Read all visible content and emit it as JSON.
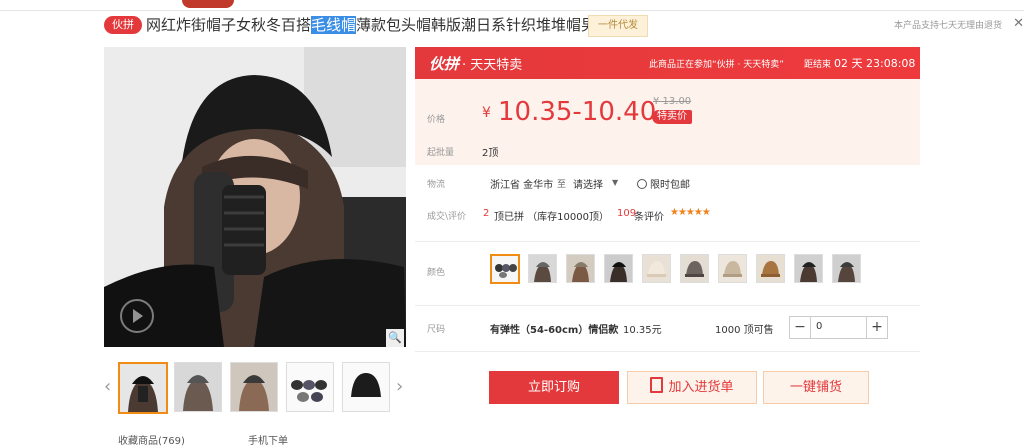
{
  "header": {
    "badge": "伙拼",
    "title_before": "网红炸街帽子女秋冬百搭",
    "title_highlight": "毛线帽",
    "title_after": "薄款包头帽韩版潮日系针织堆堆帽男",
    "dropship_tag": "一件代发",
    "return_note": "本产品支持七天无理由退货",
    "close_icon": "✕"
  },
  "banner": {
    "logo": "伙拼",
    "logo_sub": "· 天天特卖",
    "note": "此商品正在参加“伙拼 · 天天特卖”",
    "ends_label": "距结束",
    "countdown": "02 天 23:08:08"
  },
  "price": {
    "label": "价格",
    "currency": "¥",
    "range": "10.35-10.40",
    "original": "¥ 13.00",
    "sale_tag": "特卖价",
    "moq_label": "起批量",
    "moq_value": "2顶"
  },
  "logistics": {
    "label": "物流",
    "origin": "浙江省 金华市",
    "to": "至",
    "dest_placeholder": "请选择",
    "shipping": "限时包邮"
  },
  "reviews": {
    "label": "成交\\评价",
    "sold_count": "2",
    "sold_text": "顶已拼 （库存10000顶）",
    "review_count": "109",
    "review_text": "条评价",
    "stars": "★★★★★"
  },
  "color": {
    "label": "颜色",
    "count": 10,
    "selected_index": 0
  },
  "size": {
    "label": "尺码",
    "option": "有弹性（54-60cm）情侣款",
    "price": "10.35元",
    "stock": "1000 顶可售",
    "minus": "−",
    "plus": "+",
    "qty": "0"
  },
  "actions": {
    "order": "立即订购",
    "cart": "加入进货单",
    "distribute": "一键铺货"
  },
  "gallery": {
    "thumb_count": 5,
    "selected_index": 0,
    "prev": "‹",
    "next": "›",
    "zoom": "🔍",
    "fav": "收藏商品(769)",
    "mobile": "手机下单"
  },
  "colors": {
    "accent_red": "#e4393c",
    "accent_orange": "#f08b14",
    "price_bg": "#fdf2ec"
  }
}
